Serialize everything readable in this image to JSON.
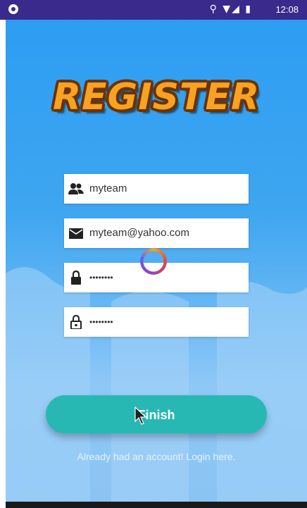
{
  "status_bar": {
    "time": "12:08",
    "icons": "⚲ ▼◢ ▮"
  },
  "title": "REGISTER",
  "form": {
    "username": "myteam",
    "email": "myteam@yahoo.com",
    "password_mask": "••••••••",
    "confirm_password_mask": "••••••••"
  },
  "finish_button": {
    "label": "Finish"
  },
  "login_link": "Already had an account! Login here.",
  "colors": {
    "primary": "#2d9df2",
    "button": "#28b8b4",
    "title": "#f7a223",
    "status_bar": "#3a2a8c"
  },
  "icons": [
    "camera-icon",
    "location-icon",
    "wifi-icon",
    "signal-icon",
    "battery-icon",
    "people-icon",
    "mail-icon",
    "lock-icon",
    "lock-open-icon",
    "loading-spinner",
    "mouse-cursor-icon"
  ]
}
